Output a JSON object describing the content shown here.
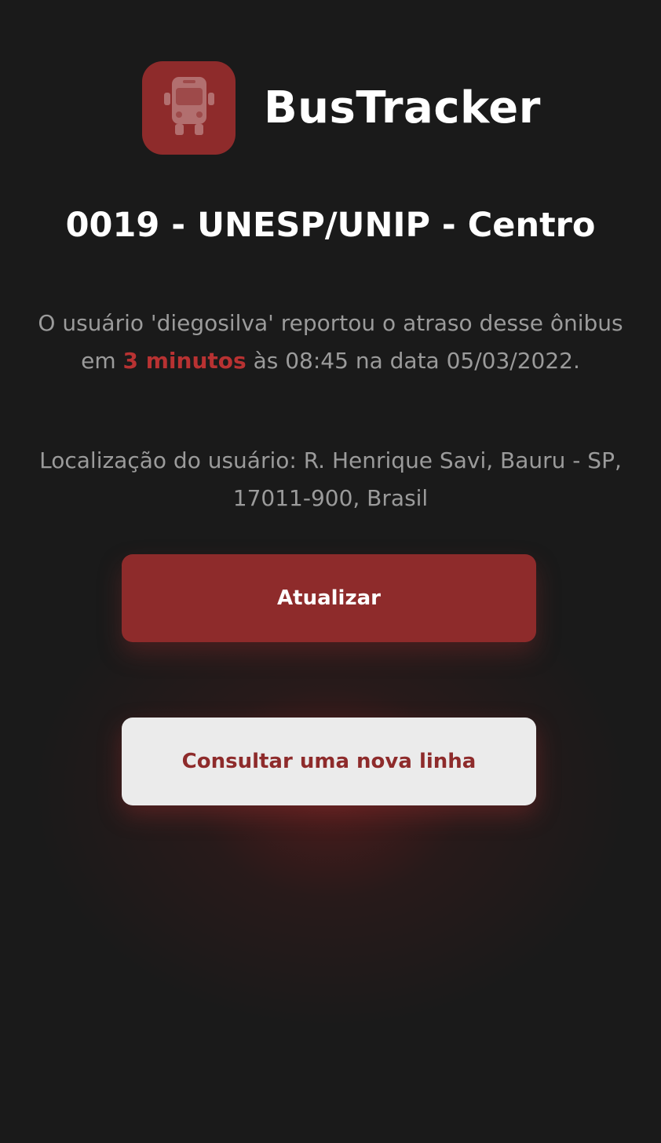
{
  "app": {
    "name": "BusTracker",
    "icon": "bus-icon",
    "accent_color": "#8e2b2b"
  },
  "line": {
    "title": "0019 - UNESP/UNIP - Centro"
  },
  "report": {
    "prefix": "O usuário 'diegosilva' reportou o atraso desse ônibus em ",
    "delay": "3 minutos",
    "suffix": " às 08:45 na data 05/03/2022."
  },
  "location": {
    "text": "Localização do usuário: R. Henrique Savi, Bauru - SP, 17011-900, Brasil"
  },
  "buttons": {
    "refresh_label": "Atualizar",
    "new_line_label": "Consultar uma nova linha"
  }
}
